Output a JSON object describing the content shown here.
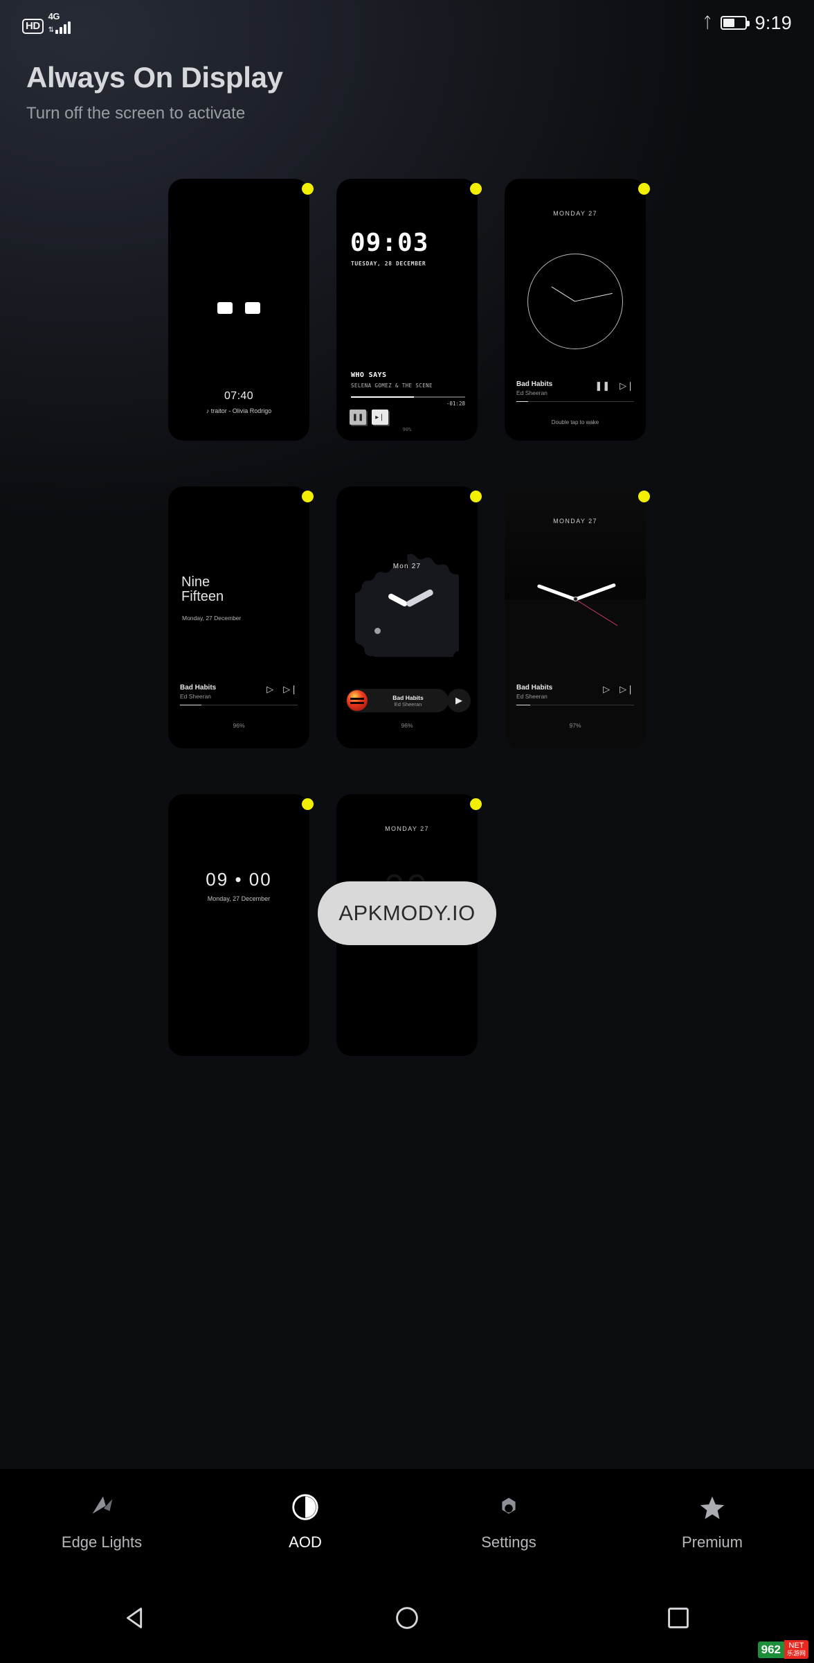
{
  "statusbar": {
    "hd": "HD",
    "network_gen": "4G",
    "updown": "⇅",
    "bluetooth_icon": "bluetooth-icon",
    "clock": "9:19"
  },
  "header": {
    "title": "Always On Display",
    "subtitle": "Turn off the screen to activate"
  },
  "colors": {
    "selected_dot": "#f2f000",
    "background": "#15181f",
    "card": "#000000"
  },
  "styles": [
    {
      "id": "style-1",
      "selected": true,
      "time": "07:40",
      "song_line": "traitor - Olivia Rodrigo",
      "note_icon": "music-note-icon"
    },
    {
      "id": "style-2",
      "selected": true,
      "time": "09:03",
      "date": "TUESDAY, 28 DECEMBER",
      "track_title": "WHO SAYS",
      "track_artist": "SELENA GOMEZ & THE SCENE",
      "remaining": "-01:28",
      "progress_pct": 55,
      "battery": "90%",
      "pause_icon": "pause-icon",
      "next_icon": "next-track-icon"
    },
    {
      "id": "style-3",
      "selected": true,
      "date": "MONDAY 27",
      "track_title": "Bad Habits",
      "track_artist": "Ed Sheeran",
      "progress_pct": 10,
      "hint": "Double tap to wake",
      "pause_icon": "pause-icon",
      "next_icon": "next-track-icon"
    },
    {
      "id": "style-4",
      "selected": true,
      "word_time_line1": "Nine",
      "word_time_line2": "Fifteen",
      "date": "Monday, 27 December",
      "track_title": "Bad Habits",
      "track_artist": "Ed Sheeran",
      "progress_pct": 18,
      "battery": "96%",
      "play_icon": "play-icon",
      "next_icon": "next-track-icon"
    },
    {
      "id": "style-5",
      "selected": true,
      "date": "Mon 27",
      "track_title": "Bad Habits",
      "track_artist": "Ed Sheeran",
      "battery": "96%",
      "play_icon": "play-icon",
      "album_art": "album-art-equals"
    },
    {
      "id": "style-6",
      "selected": true,
      "date": "MONDAY 27",
      "track_title": "Bad Habits",
      "track_artist": "Ed Sheeran",
      "progress_pct": 12,
      "battery": "97%",
      "play_icon": "play-icon",
      "next_icon": "next-track-icon"
    },
    {
      "id": "style-7",
      "selected": true,
      "time": "09 • 00",
      "date": "Monday, 27 December"
    },
    {
      "id": "style-8",
      "selected": true,
      "date": "MONDAY 27"
    }
  ],
  "watermark": {
    "text": "APKMODY.IO"
  },
  "bottom_nav": {
    "items": [
      {
        "label": "Edge Lights",
        "icon": "edge-lights-icon",
        "active": false
      },
      {
        "label": "AOD",
        "icon": "aod-clock-icon",
        "active": true
      },
      {
        "label": "Settings",
        "icon": "gear-icon",
        "active": false
      },
      {
        "label": "Premium",
        "icon": "star-icon",
        "active": false
      }
    ]
  },
  "system_nav": {
    "back": "back-triangle-icon",
    "home": "home-circle-icon",
    "recents": "recents-square-icon"
  },
  "site_watermark": {
    "primary": "962",
    "secondary_top": "NET",
    "secondary_bottom": "乐游网"
  }
}
